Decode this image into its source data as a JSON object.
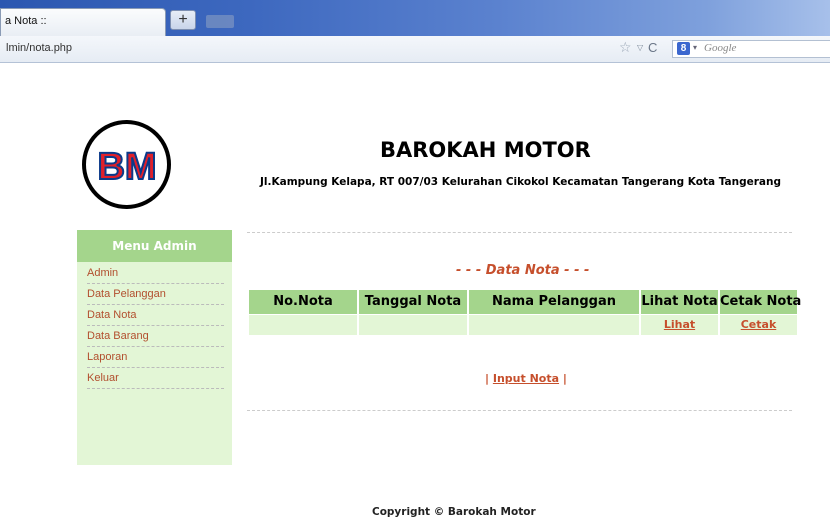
{
  "browser": {
    "tab_title": "a Nota ::",
    "new_tab_label": "+",
    "url": "lmin/nota.php",
    "search_engine_badge": "8",
    "search_placeholder": "Google"
  },
  "header": {
    "logo_text": "BM",
    "site_title": "BAROKAH MOTOR",
    "address": "Jl.Kampung Kelapa, RT 007/03 Kelurahan Cikokol Kecamatan Tangerang Kota Tangerang"
  },
  "sidebar": {
    "title": "Menu Admin",
    "items": [
      {
        "label": "Admin"
      },
      {
        "label": "Data Pelanggan"
      },
      {
        "label": "Data Nota"
      },
      {
        "label": "Data Barang"
      },
      {
        "label": "Laporan"
      },
      {
        "label": "Keluar"
      }
    ]
  },
  "main": {
    "section_title": "- - - Data Nota - - -",
    "table": {
      "headers": [
        "No.Nota",
        "Tanggal Nota",
        "Nama Pelanggan",
        "Lihat Nota",
        "Cetak Nota"
      ],
      "rows": [
        {
          "no": "",
          "tanggal": "",
          "nama": "",
          "lihat": "Lihat",
          "cetak": "Cetak"
        }
      ]
    },
    "input_prefix": "|",
    "input_link": "Input Nota",
    "input_suffix": "|"
  },
  "footer": {
    "copyright": "Copyright © Barokah Motor"
  },
  "colors": {
    "accent_green": "#a4d58c",
    "light_green": "#e3f6d6",
    "link_orange": "#c64f2c"
  },
  "icons": [
    "star-icon",
    "dropdown-icon",
    "reload-icon",
    "google-icon"
  ]
}
